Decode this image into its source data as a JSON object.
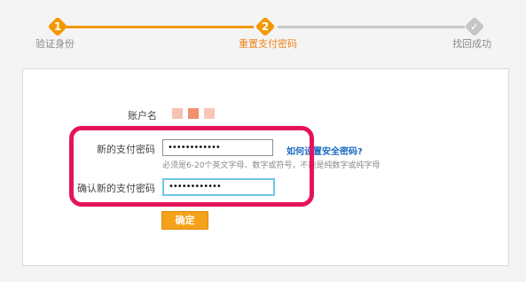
{
  "steps": [
    {
      "number": "1",
      "label": "验证身份",
      "state": "done"
    },
    {
      "number": "2",
      "label": "重置支付密码",
      "state": "current"
    },
    {
      "number": "✓",
      "label": "找回成功",
      "state": "pending"
    }
  ],
  "form": {
    "account_label": "账户名",
    "new_password_label": "新的支付密码",
    "new_password_value": "••••••••••••",
    "help_link": "如何设置安全密码?",
    "hint": "必须是6-20个英文字母、数字或符号，不能是纯数字或纯字母",
    "confirm_label": "确认新的支付密码",
    "confirm_value": "••••••••••••",
    "submit_label": "确定"
  },
  "colors": {
    "accent": "#f39800",
    "inactive": "#c6c6c6",
    "annotation": "#e5135d",
    "link": "#1a6bc1",
    "focus": "#6fc7e8"
  }
}
